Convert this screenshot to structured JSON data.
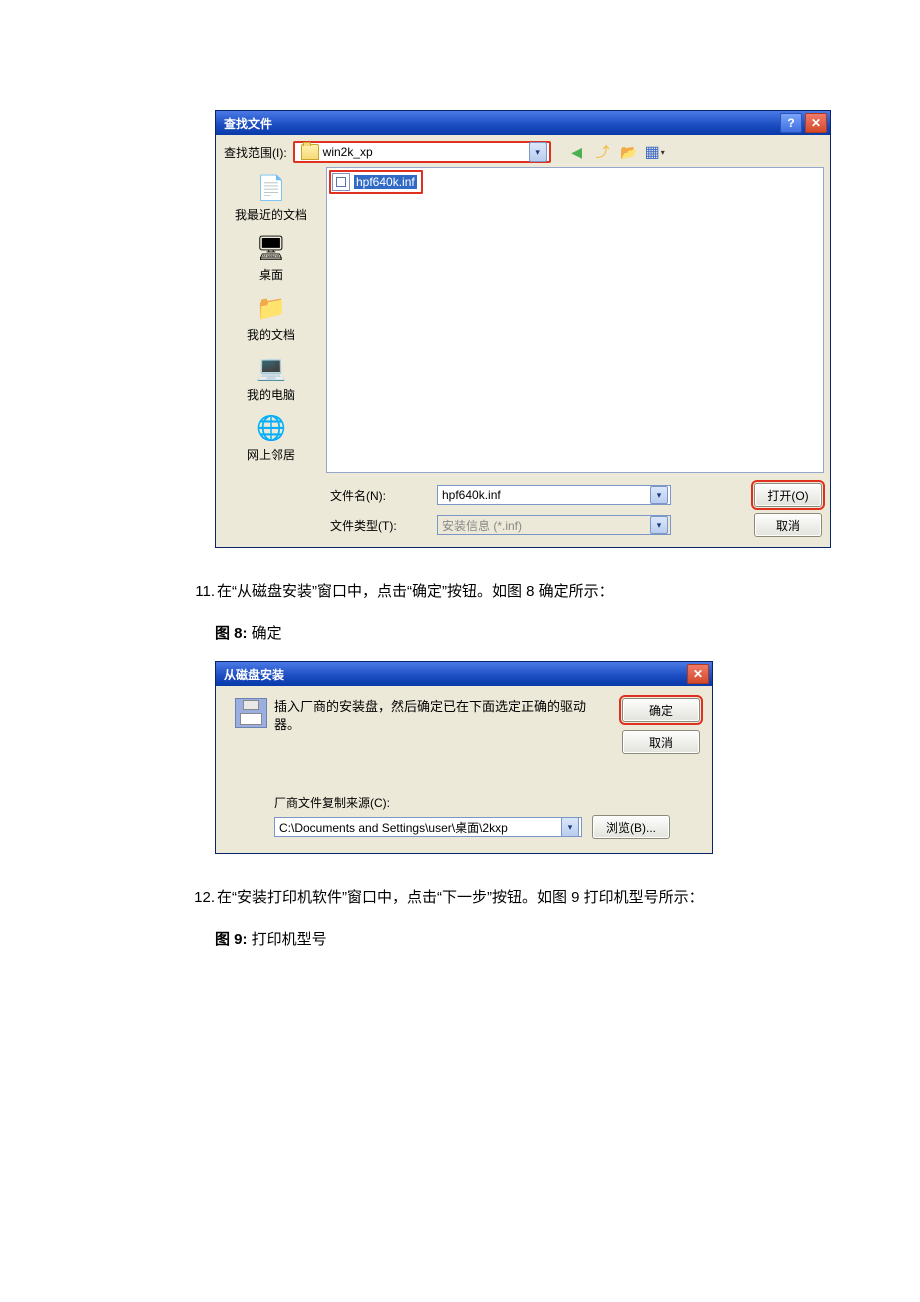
{
  "dialog1": {
    "title": "查找文件",
    "look_in_label": "查找范围(I):",
    "look_in_value": "win2k_xp",
    "selected_file": "hpf640k.inf",
    "places": [
      {
        "label": "我最近的文档",
        "glyph": "📄"
      },
      {
        "label": "桌面",
        "glyph": "🖥"
      },
      {
        "label": "我的文档",
        "glyph": "📁"
      },
      {
        "label": "我的电脑",
        "glyph": "💻"
      },
      {
        "label": "网上邻居",
        "glyph": "🌐"
      }
    ],
    "filename_label": "文件名(N):",
    "filename_value": "hpf640k.inf",
    "filetype_label": "文件类型(T):",
    "filetype_value": "安装信息 (*.inf)",
    "open_btn": "打开(O)",
    "cancel_btn": "取消"
  },
  "step11": {
    "num": "11.",
    "text": "在“从磁盘安装”窗口中，点击“确定”按钮。如图 8 确定所示："
  },
  "fig8": {
    "bold": "图 8:",
    "text": " 确定"
  },
  "dialog2": {
    "title": "从磁盘安装",
    "message": "插入厂商的安装盘，然后确定已在下面选定正确的驱动器。",
    "ok_btn": "确定",
    "cancel_btn": "取消",
    "source_label": "厂商文件复制来源(C):",
    "source_value": "C:\\Documents and Settings\\user\\桌面\\2kxp",
    "browse_btn": "浏览(B)..."
  },
  "step12": {
    "num": "12.",
    "text": "在“安装打印机软件”窗口中，点击“下一步”按钮。如图 9 打印机型号所示："
  },
  "fig9": {
    "bold": "图 9:",
    "text": " 打印机型号"
  }
}
